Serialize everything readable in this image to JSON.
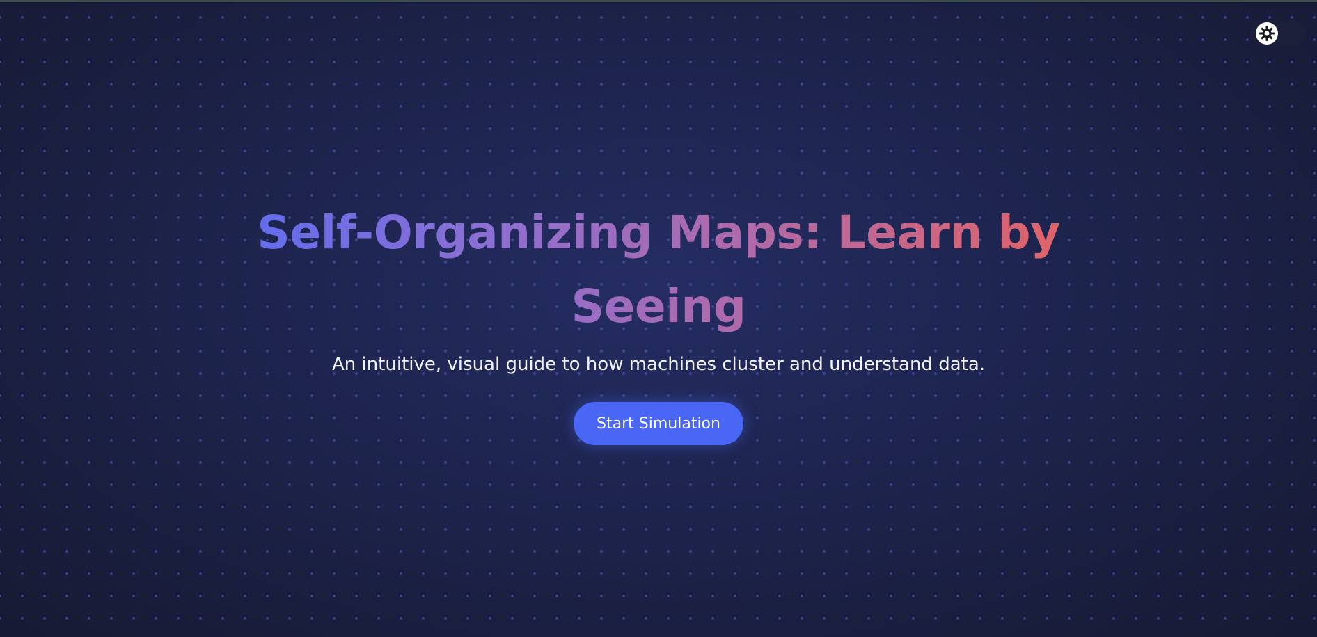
{
  "hero": {
    "title": "Self-Organizing Maps: Learn by Seeing",
    "subtitle": "An intuitive, visual guide to how machines cluster and understand data.",
    "cta_label": "Start Simulation"
  },
  "theme_toggle": {
    "icon": "sun-icon",
    "state": "light"
  },
  "colors": {
    "background": "#1e2550",
    "accent": "#4a66f5",
    "title_gradient_start": "#5b6cf0",
    "title_gradient_end": "#e6625f",
    "dot_grid": "#5668e6"
  }
}
